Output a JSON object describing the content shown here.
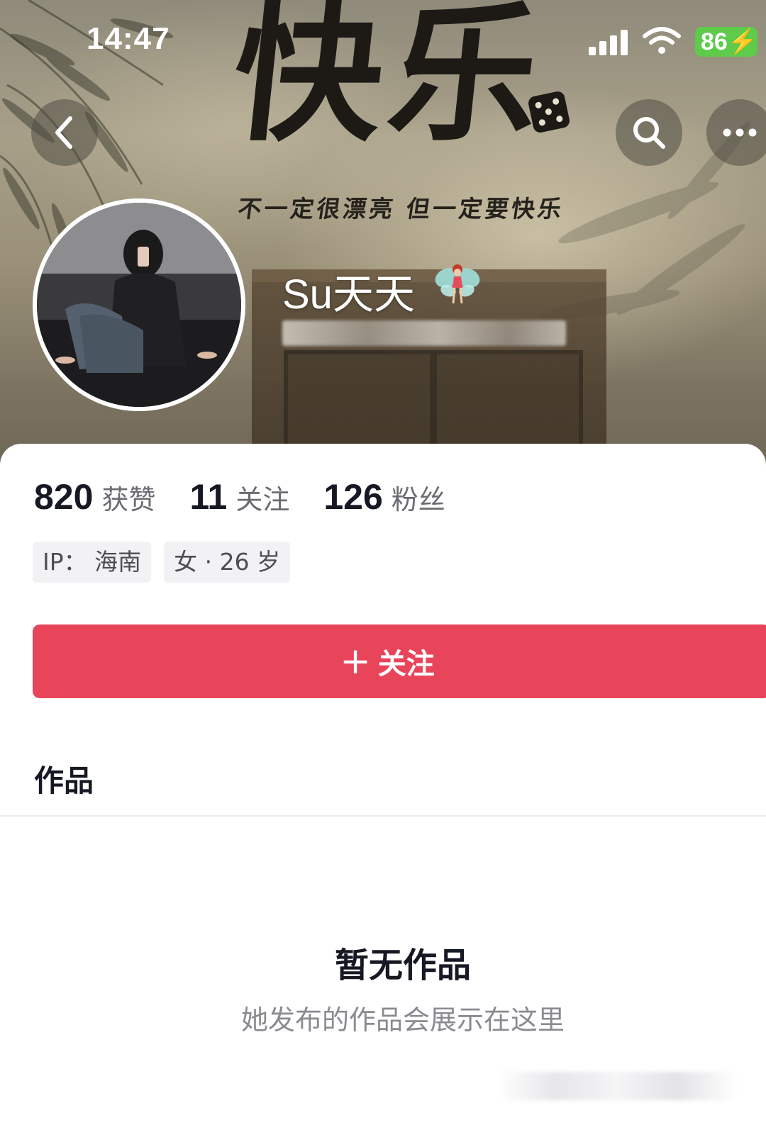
{
  "status_bar": {
    "time": "14:47",
    "battery": "86"
  },
  "cover": {
    "title": "快乐",
    "slogan": "不一定很漂亮 但一定要快乐"
  },
  "profile": {
    "name": "Su天天"
  },
  "stats": [
    {
      "value": "820",
      "label": "获赞"
    },
    {
      "value": "11",
      "label": "关注"
    },
    {
      "value": "126",
      "label": "粉丝"
    }
  ],
  "tags": [
    {
      "text": "IP： 海南"
    },
    {
      "text": "女 · 26 岁"
    }
  ],
  "follow_button": {
    "plus": "+",
    "label": "关注"
  },
  "tabs": {
    "works": "作品"
  },
  "empty_state": {
    "title": "暂无作品",
    "subtitle": "她发布的作品会展示在这里"
  },
  "colors": {
    "accent": "#e8445a",
    "battery": "#5ecb4b",
    "text_primary": "#161823",
    "text_secondary": "#8a8b91"
  },
  "icons": [
    "back-icon",
    "search-icon",
    "more-icon",
    "signal-icon",
    "wifi-icon",
    "fairy-icon",
    "dice-icon"
  ]
}
